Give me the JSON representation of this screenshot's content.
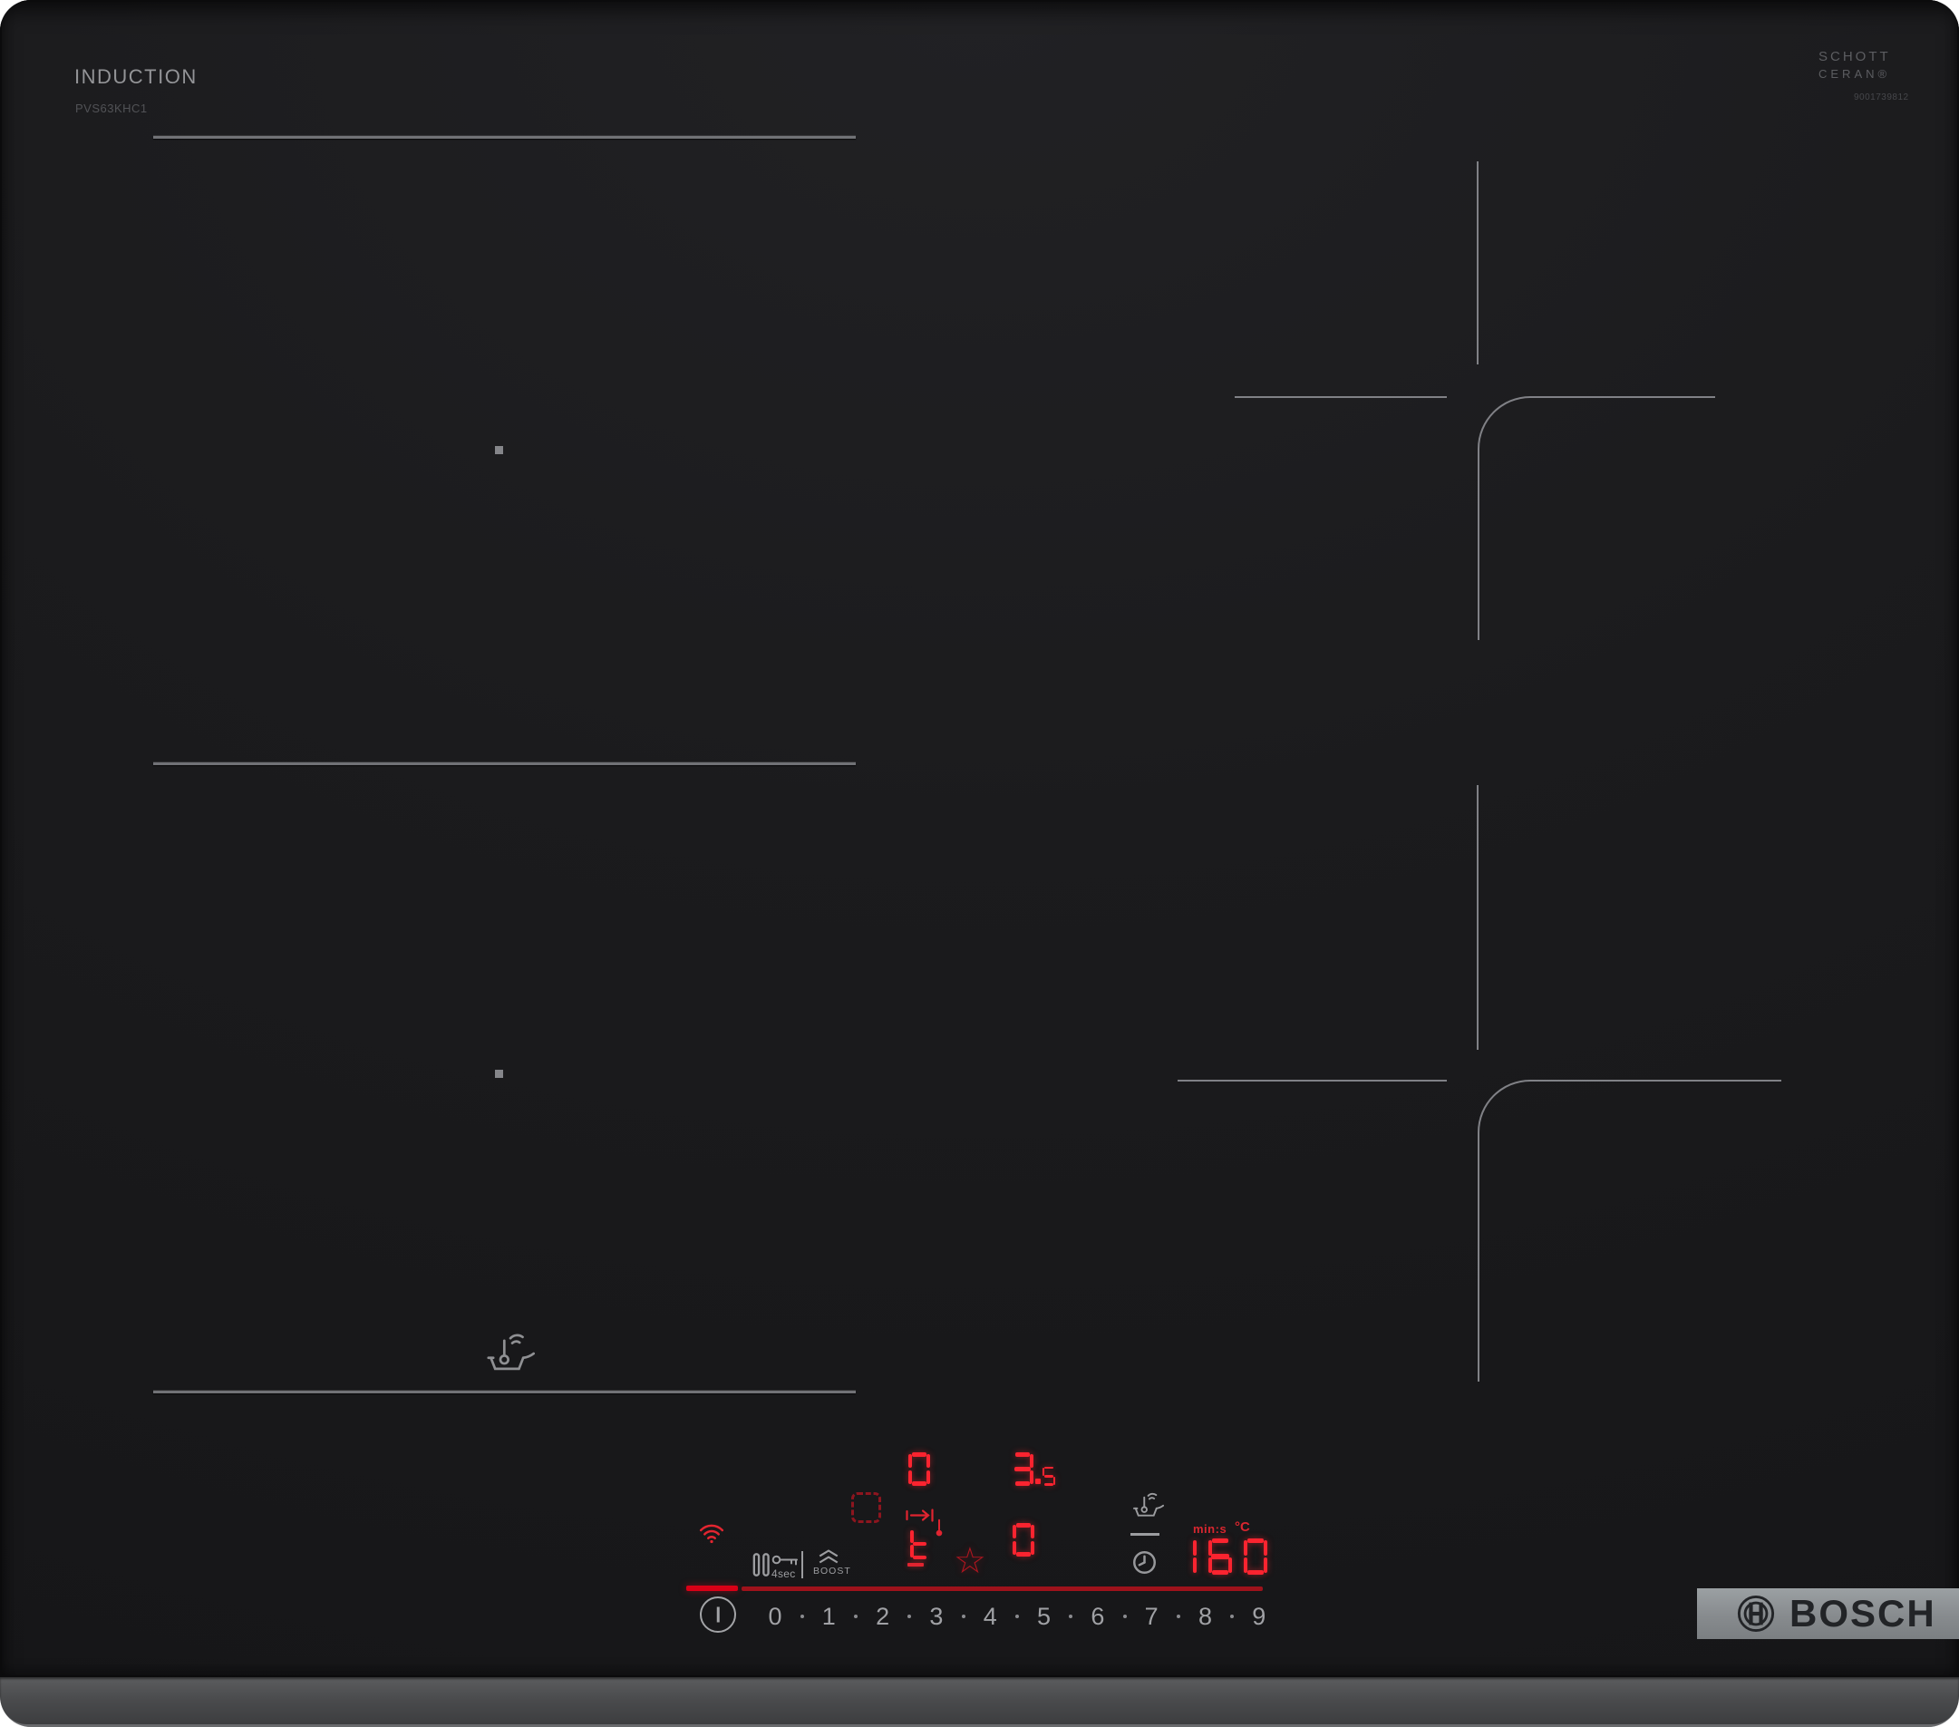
{
  "device": {
    "product_line": "INDUCTION",
    "model": "PVS63KHC1",
    "glass_brand_line1": "SCHOTT",
    "glass_brand_line2": "CERAN®",
    "glass_code": "9001739812",
    "brand": "BOSCH"
  },
  "controls": {
    "lock_hold_label": "4sec",
    "boost_label": "BOOST",
    "timer_units_label": "min:s",
    "temp_unit_label": "°C",
    "star_glyph": "☆",
    "power_levels": [
      "0",
      "1",
      "2",
      "3",
      "4",
      "5",
      "6",
      "7",
      "8",
      "9"
    ],
    "displays": {
      "left_zone_level": "0",
      "right_zone_level": "3.5",
      "flex_indicator": "t",
      "timer_value": "0",
      "sensor_temp": "160"
    }
  },
  "icons": {
    "wifi": "wifi-icon",
    "pause": "pause-icon",
    "key_lock": "key-lock-icon",
    "boost": "boost-chevrons-icon",
    "power": "power-icon",
    "pan_detect": "pan-detect-dashed-icon",
    "move_to_sensor": "arrow-to-bar-icon",
    "thermometer": "thermometer-icon",
    "favorite_star": "star-icon",
    "cooking_sensor": "cooking-sensor-pan-icon",
    "timer_clock": "clock-icon",
    "bosch_logo": "bosch-logo-icon"
  },
  "colors": {
    "glass": "#1a1a1c",
    "display_red": "#fb2430",
    "slider_red_bright": "#d90016",
    "slider_red_dim": "#9e121b",
    "zone_line_gray": "#717276",
    "icon_gray": "#9c9da0",
    "logo_band_gray": "#8b9094"
  }
}
